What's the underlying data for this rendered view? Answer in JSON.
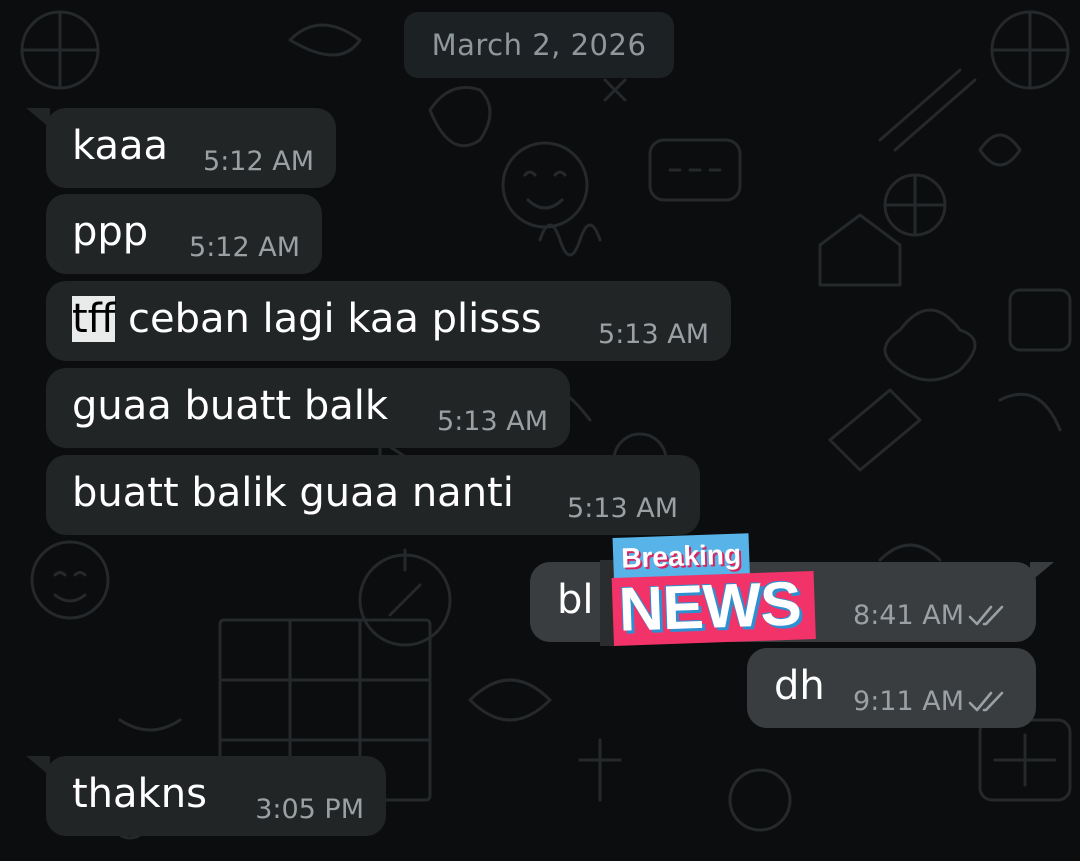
{
  "chat": {
    "date_label": "March 2, 2026",
    "messages": [
      {
        "direction": "in",
        "text": "kaaa",
        "time": "5:12 AM"
      },
      {
        "direction": "in",
        "text": "ppp",
        "time": "5:12 AM"
      },
      {
        "direction": "in",
        "text_highlight": "tff",
        "text": " ceban lagi kaa plisss",
        "time": "5:13 AM"
      },
      {
        "direction": "in",
        "text": "guaa buatt balk",
        "time": "5:13 AM"
      },
      {
        "direction": "in",
        "text": "buatt balik guaa nanti",
        "time": "5:13 AM"
      },
      {
        "direction": "out",
        "text": "bl",
        "time": "8:41 AM",
        "status": "read",
        "status_icon": "double-check-icon"
      },
      {
        "direction": "out",
        "text": "dh",
        "time": "9:11 AM",
        "status": "read",
        "status_icon": "double-check-icon"
      },
      {
        "direction": "in",
        "text": "thakns",
        "time": "3:05 PM"
      }
    ]
  },
  "sticker": {
    "line1": "Breaking",
    "line2": "NEWS",
    "icon": "breaking-news-sticker"
  },
  "colors": {
    "background": "#0b0d0e",
    "incoming_bubble": "#222526",
    "outgoing_bubble": "#3a3d3f",
    "date_chip": "#1c2124",
    "message_text": "#ffffff",
    "time_text": "#9aa0a3",
    "sticker_blue": "#58b3e8",
    "sticker_pink": "#f2336a"
  }
}
